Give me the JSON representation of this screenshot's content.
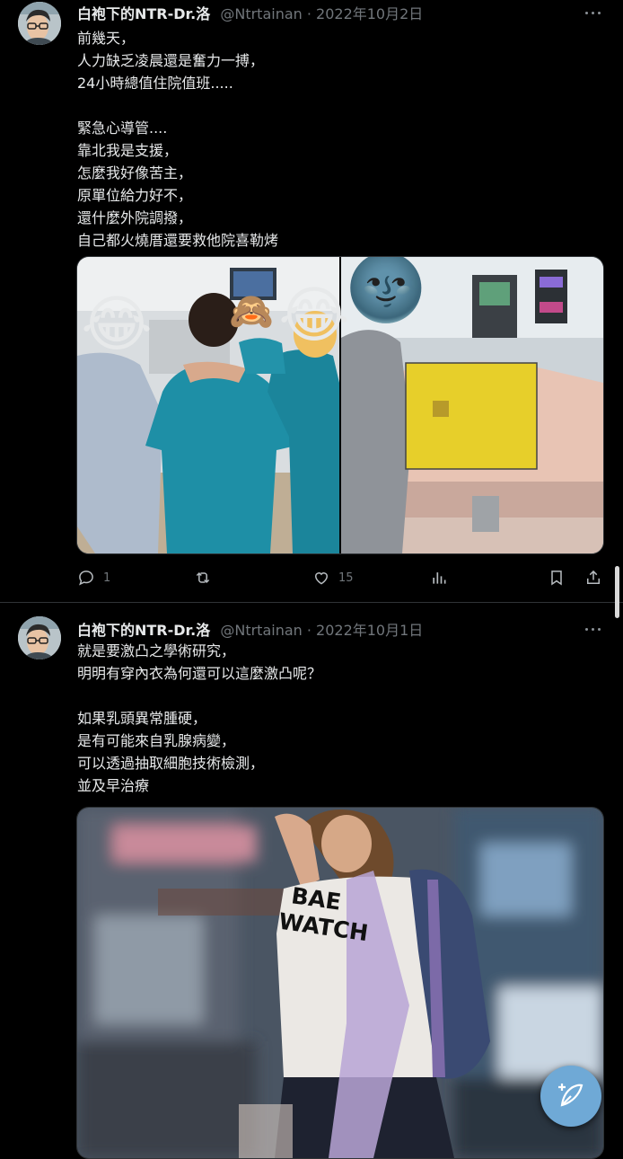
{
  "tweets": [
    {
      "author_name": "白袍下的NTR-Dr.洛",
      "meta": "@Ntrtainan · 2022年10月2日",
      "lines": [
        "前幾天，",
        "人力缺乏凌晨還是奮力一搏，",
        "24小時總值住院值班.....",
        "",
        "緊急心導管....",
        "靠北我是支援，",
        "怎麼我好像苦主，",
        "原單位給力好不，",
        "還什麼外院調撥，",
        "自己都火燒厝還要救他院喜勒烤"
      ],
      "media_left_emojis": [
        "😂",
        "🙈",
        "😂"
      ],
      "media_right_emoji": "🌚",
      "actions": {
        "replies": "1",
        "retweets": "",
        "likes": "15"
      }
    },
    {
      "author_name": "白袍下的NTR-Dr.洛",
      "meta": "@Ntrtainan · 2022年10月1日",
      "lines": [
        "就是要激凸之學術研究，",
        "明明有穿內衣為何還可以這麼激凸呢？",
        "",
        "如果乳頭異常腫硬，",
        "是有可能來自乳腺病變，",
        "可以透過抽取細胞技術檢測，",
        "並及早治療"
      ],
      "shirt_text": [
        "BAE",
        "WATCH"
      ]
    }
  ],
  "icons": [
    "more-icon",
    "reply-icon",
    "retweet-icon",
    "like-icon",
    "analytics-icon",
    "bookmark-icon",
    "share-icon",
    "compose-icon"
  ],
  "colors": {
    "background": "#000000",
    "text": "#e7e9ea",
    "secondary": "#71767b",
    "compose": "#6fa9d6",
    "scrubs": "#1e8fa6"
  }
}
